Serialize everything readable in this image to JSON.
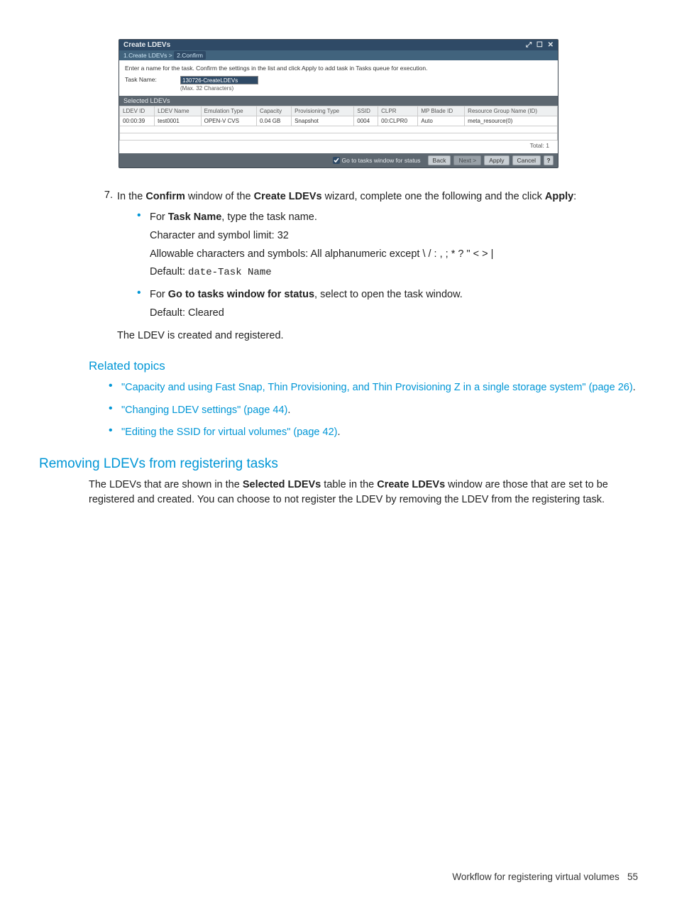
{
  "wizard": {
    "title": "Create LDEVs",
    "breadcrumb": {
      "prev": "1.Create LDEVs",
      "sep": ">",
      "current": "2.Confirm"
    },
    "instruction": "Enter a name for the task. Confirm the settings in the list and click Apply to add task in Tasks queue for execution.",
    "task_label": "Task Name:",
    "task_value": "130726-CreateLDEVs",
    "task_hint": "(Max. 32 Characters)",
    "table_title": "Selected LDEVs",
    "headers": {
      "ldev_id": "LDEV ID",
      "ldev_name": "LDEV Name",
      "emulation": "Emulation Type",
      "capacity": "Capacity",
      "prov": "Provisioning Type",
      "ssid": "SSID",
      "clpr": "CLPR",
      "mp": "MP Blade ID",
      "res": "Resource Group Name (ID)"
    },
    "row": {
      "ldev_id": "00:00:39",
      "ldev_name": "test0001",
      "emulation": "OPEN-V CVS",
      "capacity": "0.04 GB",
      "prov": "Snapshot",
      "ssid": "0004",
      "clpr": "00:CLPR0",
      "mp": "Auto",
      "res": "meta_resource(0)"
    },
    "total_label": "Total:",
    "total_value": "1",
    "goto_label": "Go to tasks window for status",
    "buttons": {
      "back": "Back",
      "next": "Next >",
      "apply": "Apply",
      "cancel": "Cancel"
    }
  },
  "doc": {
    "step_num": "7.",
    "step_text_parts": {
      "a": "In the ",
      "b": "Confirm",
      "c": " window of the ",
      "d": "Create LDEVs",
      "e": " wizard, complete one the following and the click ",
      "f": "Apply",
      "g": ":"
    },
    "b1": {
      "a": "For ",
      "b": "Task Name",
      "c": ", type the task name.",
      "l1": "Character and symbol limit: 32",
      "l2": "Allowable characters and symbols: All alphanumeric except \\ / : , ; * ? \" < > |",
      "l3a": "Default: ",
      "l3b": "date-Task Name"
    },
    "b2": {
      "a": "For ",
      "b": "Go to tasks window for status",
      "c": ", select to open the task window.",
      "l1": "Default: Cleared"
    },
    "after": "The LDEV is created and registered.",
    "related_h": "Related topics",
    "rel1a": "\"Capacity and using Fast Snap, Thin Provisioning, and Thin Provisioning Z in a single storage system\" (page 26)",
    "rel2a": "\"Changing LDEV settings\" (page 44)",
    "rel3a": "\"Editing the SSID for virtual volumes\" (page 42)",
    "dot": ".",
    "sec_h": "Removing LDEVs from registering tasks",
    "sec_p_parts": {
      "a": "The LDEVs that are shown in the ",
      "b": "Selected LDEVs",
      "c": " table in the ",
      "d": "Create LDEVs",
      "e": " window are those that are set to be registered and created. You can choose to not register the LDEV by removing the LDEV from the registering task."
    },
    "footer_a": "Workflow for registering virtual volumes",
    "footer_b": "55"
  }
}
